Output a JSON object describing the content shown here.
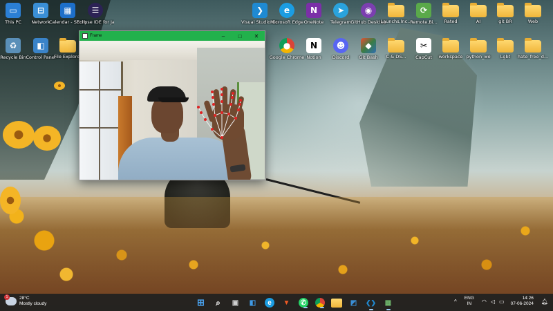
{
  "desktop_icons": [
    {
      "label": "This PC",
      "icon": "computer-icon",
      "color": "#2b7fd4"
    },
    {
      "label": "Network",
      "icon": "network-icon",
      "color": "#3a8fd6"
    },
    {
      "label": "Calendar - Shortcut",
      "icon": "calendar-icon",
      "color": "#1d6fc9"
    },
    {
      "label": "Eclipse IDE for Java De...",
      "icon": "eclipse-icon",
      "color": "#2c2255"
    },
    {
      "label": "Visual Studio Code",
      "icon": "vscode-icon",
      "color": "#1f8ad2"
    },
    {
      "label": "Microsoft Edge",
      "icon": "edge-icon",
      "color": "#1b9de2"
    },
    {
      "label": "OneNote",
      "icon": "onenote-icon",
      "color": "#7b2fa8"
    },
    {
      "label": "Telegram",
      "icon": "telegram-icon",
      "color": "#2aa3dd"
    },
    {
      "label": "GitHub Desktop",
      "icon": "github-desktop-icon",
      "color": "#7b3fb0"
    },
    {
      "label": "Launchs,Inc...",
      "icon": "folder-icon",
      "color": "#f0b63a"
    },
    {
      "label": "Remote,Bi...",
      "icon": "remote-app-icon",
      "color": "#5aa94a"
    },
    {
      "label": "Rated",
      "icon": "folder-icon",
      "color": "#f0b63a"
    },
    {
      "label": "AI",
      "icon": "folder-icon",
      "color": "#f0b63a"
    },
    {
      "label": "git BR",
      "icon": "folder-icon",
      "color": "#f0b63a"
    },
    {
      "label": "Web",
      "icon": "folder-icon",
      "color": "#f0b63a"
    },
    {
      "label": "Recycle Bin",
      "icon": "recycle-bin-icon",
      "color": "#5a8fb8"
    },
    {
      "label": "Control Panel",
      "icon": "control-panel-icon",
      "color": "#3a83c8"
    },
    {
      "label": "File Explorer",
      "icon": "file-explorer-icon",
      "color": "#f0b63a"
    },
    {
      "label": "Google Chrome",
      "icon": "chrome-icon",
      "color": "#e9e9e9"
    },
    {
      "label": "Notion",
      "icon": "notion-icon",
      "color": "#ffffff"
    },
    {
      "label": "Discord",
      "icon": "discord-icon",
      "color": "#5865f2"
    },
    {
      "label": "Git Bash",
      "icon": "git-bash-icon",
      "color": "#3a7d44"
    },
    {
      "label": "C & DS...",
      "icon": "folder-icon",
      "color": "#f0b63a"
    },
    {
      "label": "CapCut",
      "icon": "capcut-icon",
      "color": "#ffffff"
    },
    {
      "label": "workspace",
      "icon": "folder-icon",
      "color": "#f0b63a"
    },
    {
      "label": "python_wo",
      "icon": "folder-icon",
      "color": "#f0b63a"
    },
    {
      "label": "Lgbt",
      "icon": "folder-icon",
      "color": "#f0b63a"
    },
    {
      "label": "hate_free_d...",
      "icon": "folder-icon",
      "color": "#f0b63a"
    }
  ],
  "camera_window": {
    "title": "Frame",
    "minimize": "–",
    "maximize": "□",
    "close": "✕",
    "titlebar_color": "#22b14c"
  },
  "taskbar": {
    "weather": {
      "temp": "28°C",
      "condition": "Mostly cloudy",
      "badge": "1"
    },
    "apps": [
      {
        "name": "start-button",
        "glyph": "⊞",
        "color": "#4aa3f0"
      },
      {
        "name": "search-button",
        "glyph": "⌕",
        "color": "#ffffff"
      },
      {
        "name": "task-view-button",
        "glyph": "▣",
        "color": "#cfcfcf"
      },
      {
        "name": "widgets-button",
        "glyph": "◧",
        "color": "#3f9be8"
      },
      {
        "name": "edge-taskbar-button",
        "glyph": "e",
        "color": "#1b9de2"
      },
      {
        "name": "brave-taskbar-button",
        "glyph": "B",
        "color": "#f05a24"
      },
      {
        "name": "whatsapp-taskbar-button",
        "glyph": "W",
        "color": "#25d366"
      },
      {
        "name": "chrome-taskbar-button",
        "glyph": "◉",
        "color": "#e8b20e"
      },
      {
        "name": "file-explorer-taskbar-button",
        "glyph": "▤",
        "color": "#f0b63a"
      },
      {
        "name": "paint-taskbar-button",
        "glyph": "◩",
        "color": "#3a8fd6"
      },
      {
        "name": "vscode-taskbar-button",
        "glyph": "❮❯",
        "color": "#1f8ad2"
      },
      {
        "name": "python-frame-taskbar-button",
        "glyph": "▦",
        "color": "#6db36a"
      }
    ],
    "tray": {
      "chevron": "^",
      "lang_top": "ENG",
      "lang_bottom": "IN",
      "wifi": "◠",
      "volume": "◁",
      "battery": "▭",
      "time": "14:26",
      "date": "07-06-2024"
    }
  }
}
